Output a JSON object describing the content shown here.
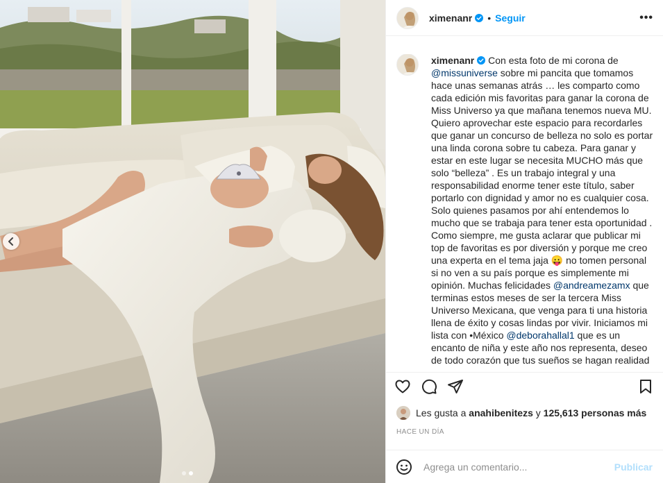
{
  "post": {
    "username": "ximenanr",
    "follow_label": "Seguir",
    "separator": "•",
    "more_label": "•••"
  },
  "caption": {
    "username": "ximenanr",
    "part1": " Con esta foto de mi corona de ",
    "mention1": "@missuniverse",
    "part2": " sobre mi pancita que tomamos hace unas semanas atrás … les comparto como cada edición mis favoritas para ganar la corona de Miss Universo ya que mañana tenemos nueva MU. Quiero aprovechar este espacio para recordarles que ganar un concurso de belleza no solo es portar una linda corona sobre tu cabeza. Para ganar y estar en este lugar se necesita MUCHO más que solo “belleza” . Es un trabajo integral y una responsabilidad enorme tener este título, saber portarlo con dignidad y amor no es cualquier cosa. Solo quienes pasamos por ahí entendemos lo mucho que se trabaja para tener esta oportunidad . Como siempre, me gusta aclarar que publicar mi top de favoritas es por diversión y porque me creo una experta en el tema jaja ",
    "emoji": "😛",
    "part3": " no tomen personal si no ven a su país porque es simplemente mi opinión. Muchas felicidades ",
    "mention2": "@andreamezamx",
    "part4": " que terminas estos meses de ser la tercera Miss Universo Mexicana, que venga para ti una historia llena de éxito y cosas lindas por vivir. Iniciamos mi lista con •México ",
    "mention3": "@deborahallal1",
    "part5": " que es un encanto de niña y este año nos representa, deseo de todo corazón que tus sueños se hagan realidad ᴍx. Siguiendo con"
  },
  "likes": {
    "prefix": "Les gusta a ",
    "user": "anahibenitezs",
    "middle": " y ",
    "count": "125,613 personas más"
  },
  "timestamp": "HACE UN DÍA",
  "comment": {
    "placeholder": "Agrega un comentario...",
    "post_label": "Publicar"
  },
  "icons": {
    "like": "heart-icon",
    "comment": "comment-icon",
    "share": "paper-plane-icon",
    "save": "bookmark-icon",
    "emoji": "smiley-icon",
    "prev": "chevron-left-icon",
    "verified": "verified-badge-icon"
  },
  "colors": {
    "link_blue": "#0095f6",
    "mention_blue": "#00376b",
    "verified_blue": "#0095f6",
    "muted": "#8e8e8e",
    "publish_disabled": "#b2dffc"
  },
  "carousel": {
    "slides": 2,
    "active_index": 1
  }
}
